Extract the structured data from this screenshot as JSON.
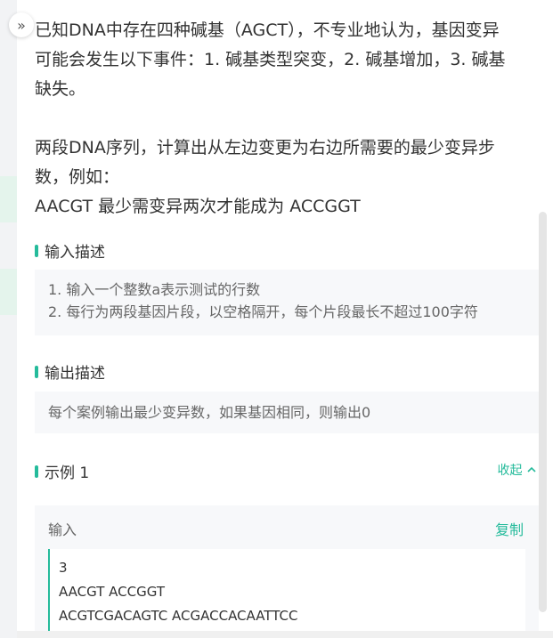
{
  "problem": {
    "description_lines": [
      "已知DNA中存在四种碱基（AGCT），不专业地认为，基因变异",
      "可能会发生以下事件：1. 碱基类型突变，2. 碱基增加，3. 碱基",
      "缺失。"
    ],
    "task_lines": [
      "两段DNA序列，计算出从左边变更为右边所需要的最少变异步",
      "数，例如：",
      "AACGT 最少需变异两次才能成为 ACCGGT"
    ]
  },
  "input_section": {
    "title": "输入描述",
    "lines": [
      "1. 输入一个整数a表示测试的行数",
      "2. 每行为两段基因片段，以空格隔开，每个片段最长不超过100字符"
    ]
  },
  "output_section": {
    "title": "输出描述",
    "text": "每个案例输出最少变异数，如果基因相同，则输出0"
  },
  "example": {
    "title": "示例 1",
    "toggle_label": "收起",
    "input_label": "输入",
    "copy_label": "复制",
    "code_lines": [
      "3",
      "AACGT ACCGGT",
      "ACGTCGACAGTC ACGACCACAATTCC"
    ]
  },
  "icons": {
    "expand": "double-chevron-right-icon",
    "collapse": "chevron-up-icon"
  },
  "colors": {
    "accent": "#25bb9b",
    "box_bg": "#f7f8fa",
    "text": "#333333",
    "muted": "#666666"
  }
}
